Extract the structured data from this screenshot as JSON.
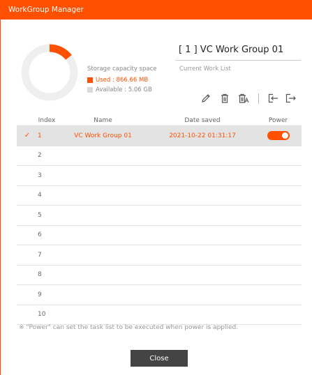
{
  "window": {
    "title": "WorkGroup Manager"
  },
  "storage": {
    "title": "Storage capacity space",
    "used_label": "Used : 866.66 MB",
    "available_label": "Available : 5.06 GB",
    "used_mb": 866.66,
    "available_gb": 5.06,
    "used_color": "#ff4f00",
    "available_color": "#efefef"
  },
  "group": {
    "name": "[ 1 ] VC Work Group 01",
    "list_label": "Current Work List"
  },
  "toolbar": {
    "icons": [
      "edit-icon",
      "delete-icon",
      "delete-all-icon",
      "import-icon",
      "export-icon"
    ]
  },
  "table": {
    "headers": {
      "index": "Index",
      "name": "Name",
      "date": "Date saved",
      "power": "Power"
    },
    "rows": [
      {
        "index": "1",
        "name": "VC Work Group 01",
        "date": "2021-10-22 01:31:17",
        "selected": true,
        "power": true
      },
      {
        "index": "2",
        "name": "",
        "date": ""
      },
      {
        "index": "3",
        "name": "",
        "date": ""
      },
      {
        "index": "4",
        "name": "",
        "date": ""
      },
      {
        "index": "5",
        "name": "",
        "date": ""
      },
      {
        "index": "6",
        "name": "",
        "date": ""
      },
      {
        "index": "7",
        "name": "",
        "date": ""
      },
      {
        "index": "8",
        "name": "",
        "date": ""
      },
      {
        "index": "9",
        "name": "",
        "date": ""
      },
      {
        "index": "10",
        "name": "",
        "date": ""
      }
    ]
  },
  "note": "※ \"Power\" can set the task list to be executed when power is applied.",
  "buttons": {
    "close": "Close"
  },
  "colors": {
    "accent": "#ff4f00",
    "button_dark": "#444444"
  }
}
